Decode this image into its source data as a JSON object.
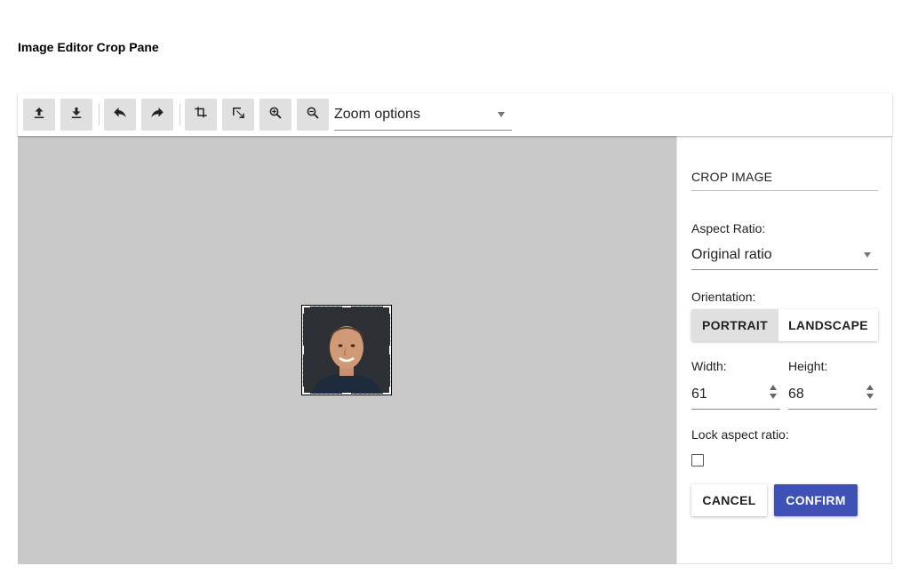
{
  "page": {
    "title": "Image Editor Crop Pane"
  },
  "toolbar": {
    "buttons": [
      {
        "name": "upload-icon"
      },
      {
        "name": "download-icon"
      },
      {
        "name": "undo-icon"
      },
      {
        "name": "redo-icon"
      },
      {
        "name": "crop-icon"
      },
      {
        "name": "resize-icon"
      },
      {
        "name": "zoom-in-icon"
      },
      {
        "name": "zoom-out-icon"
      }
    ],
    "zoom_select": {
      "value": "Zoom options"
    }
  },
  "canvas": {
    "background": "#c8c8c8",
    "image_subject": "portrait photo of smiling man"
  },
  "crop_panel": {
    "title": "CROP IMAGE",
    "aspect_ratio_label": "Aspect Ratio:",
    "aspect_ratio_value": "Original ratio",
    "orientation_label": "Orientation:",
    "orientation_options": [
      "PORTRAIT",
      "LANDSCAPE"
    ],
    "orientation_selected": "PORTRAIT",
    "width_label": "Width:",
    "width_value": "61",
    "height_label": "Height:",
    "height_value": "68",
    "lock_label": "Lock aspect ratio:",
    "lock_checked": false,
    "cancel_label": "CANCEL",
    "confirm_label": "CONFIRM",
    "accent_color": "#3f51b5"
  }
}
